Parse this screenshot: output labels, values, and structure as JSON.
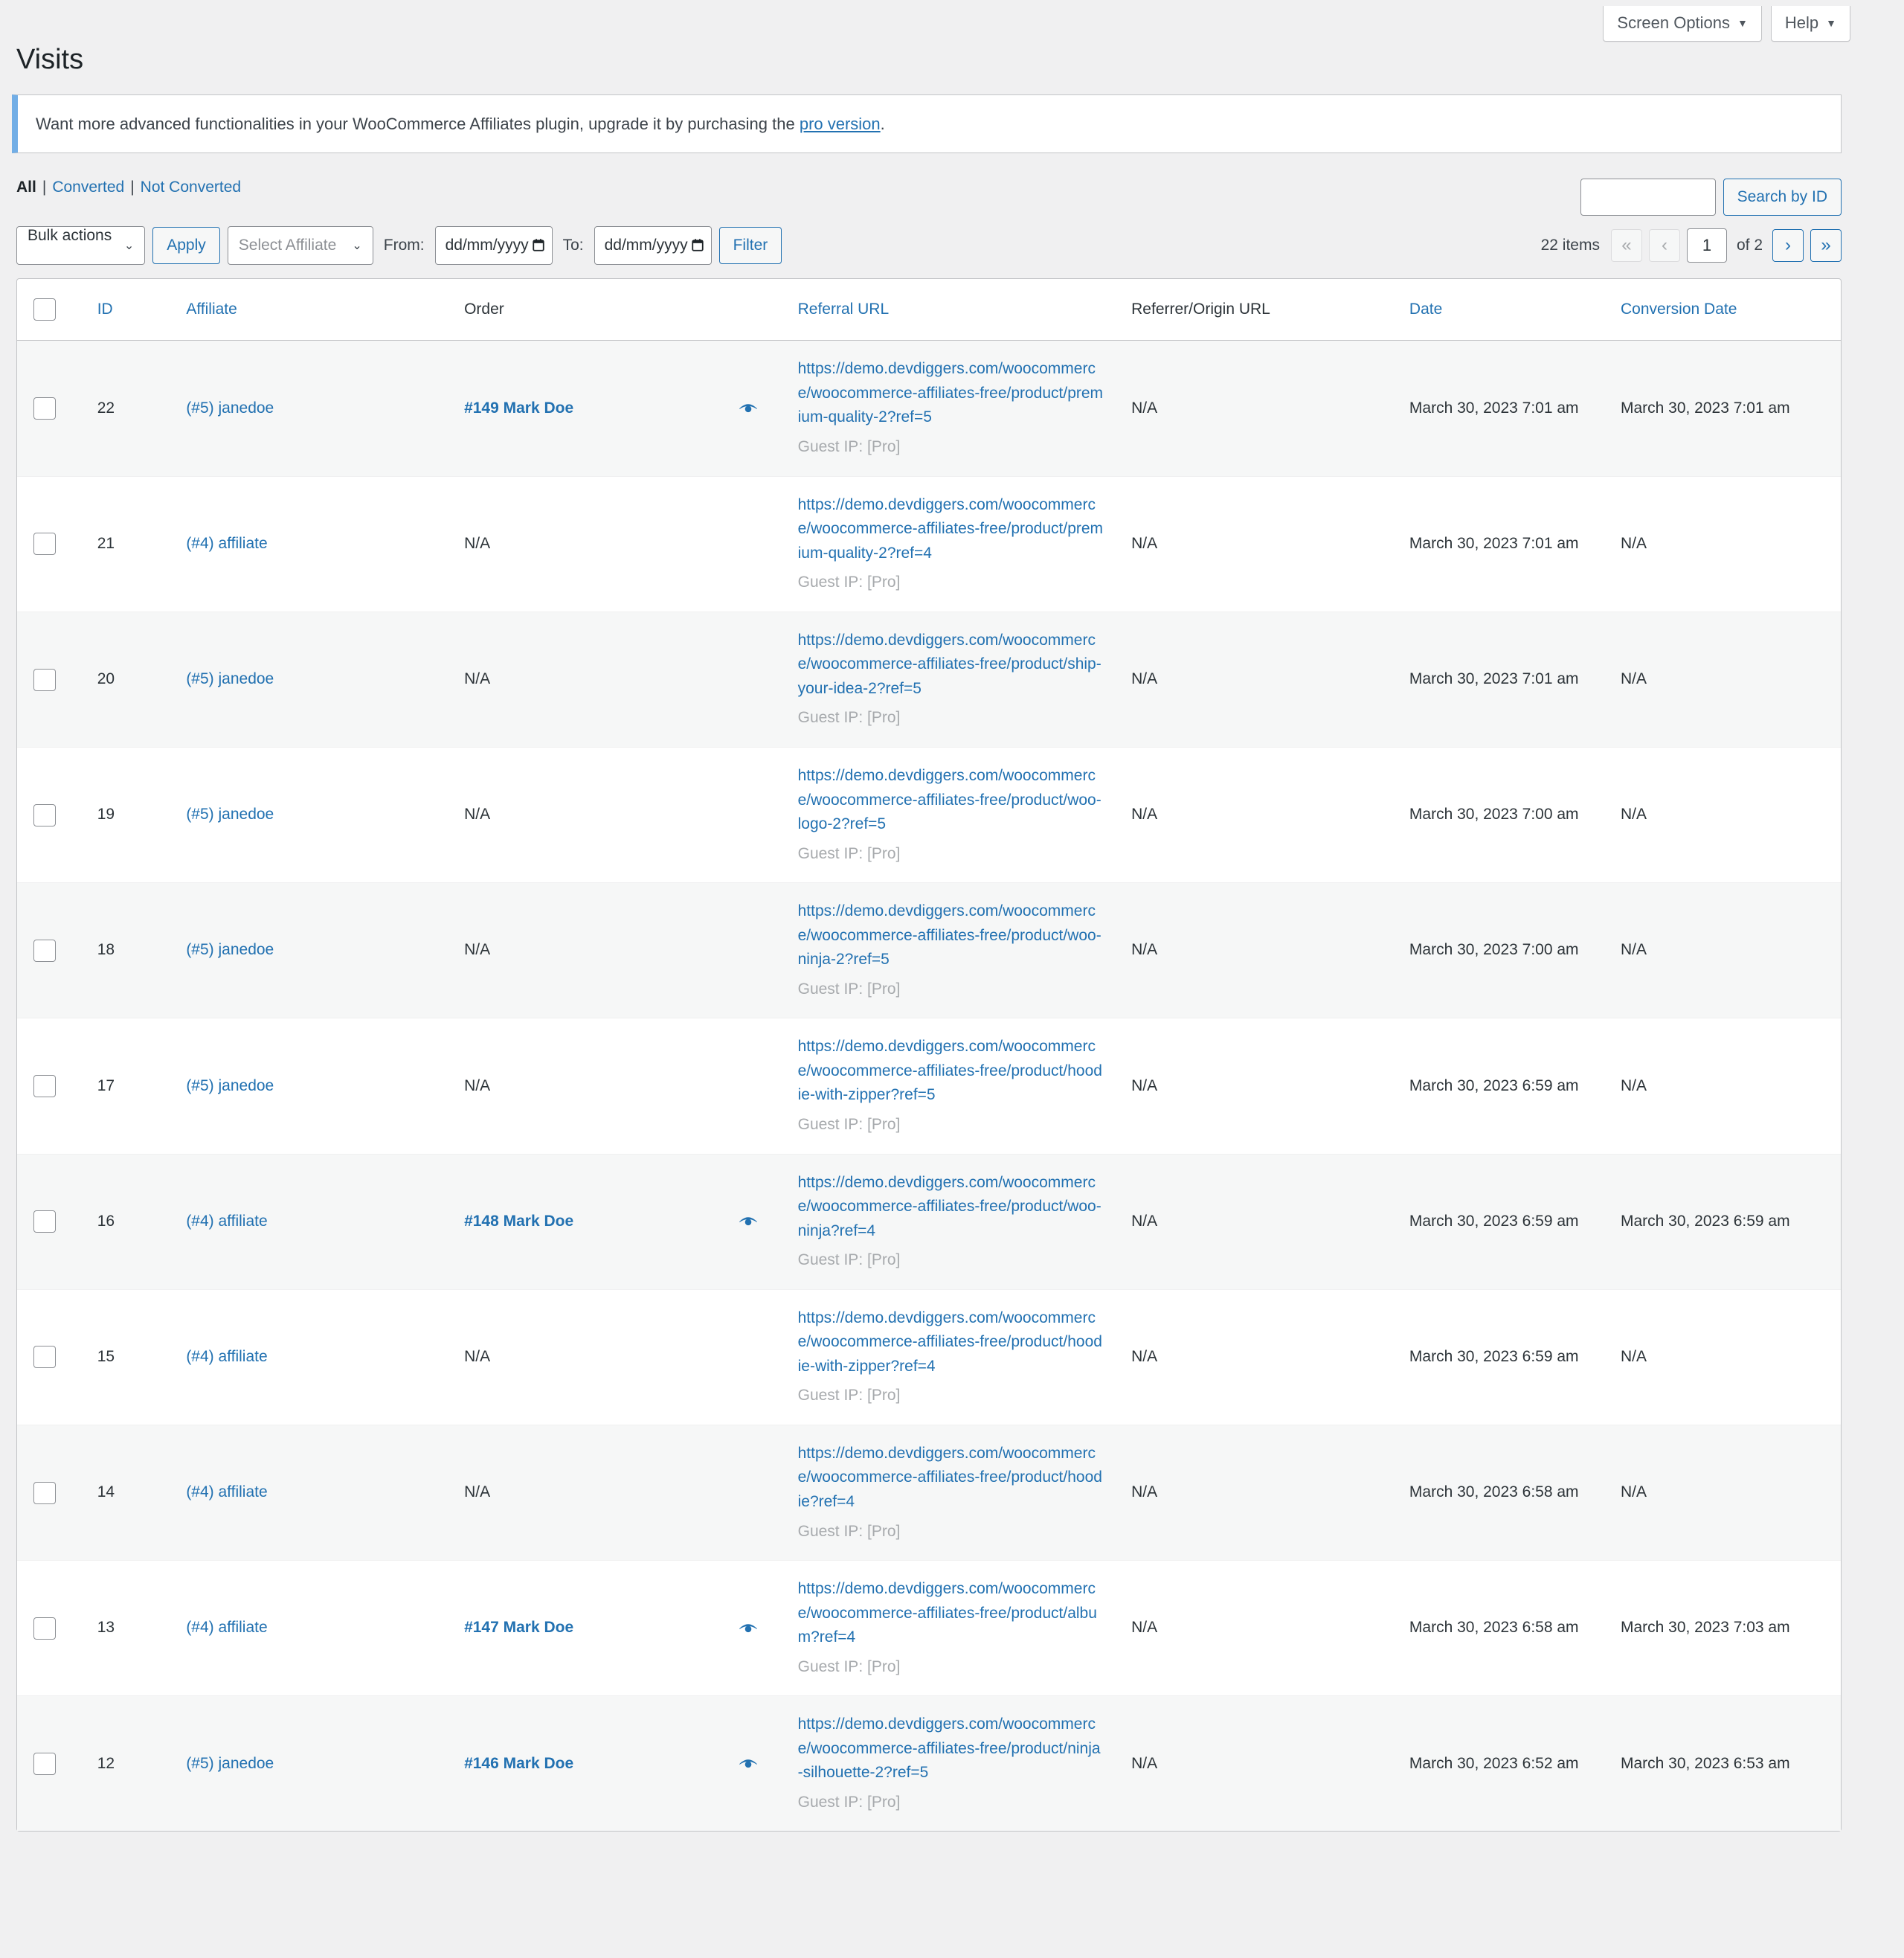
{
  "topbar": {
    "screen_options_label": "Screen Options",
    "help_label": "Help",
    "caret": "▼"
  },
  "page": {
    "title": "Visits"
  },
  "notice": {
    "text_before": "Want more advanced functionalities in your WooCommerce Affiliates plugin, upgrade it by purchasing the ",
    "link_label": "pro version",
    "text_after": "."
  },
  "views": {
    "all": "All",
    "converted": "Converted",
    "not_converted": "Not Converted",
    "separator": "|"
  },
  "search": {
    "value": "",
    "placeholder": "",
    "button_label": "Search by ID"
  },
  "toolbar": {
    "bulk_actions_label": "Bulk actions",
    "apply_label": "Apply",
    "select_affiliate_label": "Select Affiliate",
    "from_label": "From:",
    "to_label": "To:",
    "date_from_value": "dd/mm/yyyy",
    "date_to_value": "dd/mm/yyyy",
    "filter_label": "Filter",
    "caret": "⌄"
  },
  "pagination": {
    "items_label": "22 items",
    "first_label": "«",
    "prev_label": "‹",
    "current_page": "1",
    "of_label": "of 2",
    "next_label": "›",
    "last_label": "»"
  },
  "table": {
    "columns": [
      {
        "key": "cb",
        "label": "",
        "sortable": false
      },
      {
        "key": "id",
        "label": "ID",
        "sortable": true
      },
      {
        "key": "affiliate",
        "label": "Affiliate",
        "sortable": true
      },
      {
        "key": "order",
        "label": "Order",
        "sortable": false
      },
      {
        "key": "referral_url",
        "label": "Referral URL",
        "sortable": true
      },
      {
        "key": "referrer_origin_url",
        "label": "Referrer/Origin URL",
        "sortable": false
      },
      {
        "key": "date",
        "label": "Date",
        "sortable": true
      },
      {
        "key": "conversion_date",
        "label": "Conversion Date",
        "sortable": true
      }
    ],
    "guest_ip_label": "Guest IP: [Pro]",
    "na_label": "N/A",
    "rows": [
      {
        "id": "22",
        "affiliate": "(#5) janedoe <janedoe@email.com>",
        "order": "#149 Mark Doe",
        "has_order_link": true,
        "has_eye_icon": true,
        "referral_url": "https://demo.devdiggers.com/woocommerce/woocommerce-affiliates-free/product/premium-quality-2?ref=5",
        "guest_ip": "Guest IP: [Pro]",
        "referrer_origin_url": "N/A",
        "date": "March 30, 2023 7:01 am",
        "conversion_date": "March 30, 2023 7:01 am"
      },
      {
        "id": "21",
        "affiliate": "(#4) affiliate <affiliate@email.com>",
        "order": "N/A",
        "has_order_link": false,
        "has_eye_icon": false,
        "referral_url": "https://demo.devdiggers.com/woocommerce/woocommerce-affiliates-free/product/premium-quality-2?ref=4",
        "guest_ip": "Guest IP: [Pro]",
        "referrer_origin_url": "N/A",
        "date": "March 30, 2023 7:01 am",
        "conversion_date": "N/A"
      },
      {
        "id": "20",
        "affiliate": "(#5) janedoe <janedoe@email.com>",
        "order": "N/A",
        "has_order_link": false,
        "has_eye_icon": false,
        "referral_url": "https://demo.devdiggers.com/woocommerce/woocommerce-affiliates-free/product/ship-your-idea-2?ref=5",
        "guest_ip": "Guest IP: [Pro]",
        "referrer_origin_url": "N/A",
        "date": "March 30, 2023 7:01 am",
        "conversion_date": "N/A"
      },
      {
        "id": "19",
        "affiliate": "(#5) janedoe <janedoe@email.com>",
        "order": "N/A",
        "has_order_link": false,
        "has_eye_icon": false,
        "referral_url": "https://demo.devdiggers.com/woocommerce/woocommerce-affiliates-free/product/woo-logo-2?ref=5",
        "guest_ip": "Guest IP: [Pro]",
        "referrer_origin_url": "N/A",
        "date": "March 30, 2023 7:00 am",
        "conversion_date": "N/A"
      },
      {
        "id": "18",
        "affiliate": "(#5) janedoe <janedoe@email.com>",
        "order": "N/A",
        "has_order_link": false,
        "has_eye_icon": false,
        "referral_url": "https://demo.devdiggers.com/woocommerce/woocommerce-affiliates-free/product/woo-ninja-2?ref=5",
        "guest_ip": "Guest IP: [Pro]",
        "referrer_origin_url": "N/A",
        "date": "March 30, 2023 7:00 am",
        "conversion_date": "N/A"
      },
      {
        "id": "17",
        "affiliate": "(#5) janedoe <janedoe@email.com>",
        "order": "N/A",
        "has_order_link": false,
        "has_eye_icon": false,
        "referral_url": "https://demo.devdiggers.com/woocommerce/woocommerce-affiliates-free/product/hoodie-with-zipper?ref=5",
        "guest_ip": "Guest IP: [Pro]",
        "referrer_origin_url": "N/A",
        "date": "March 30, 2023 6:59 am",
        "conversion_date": "N/A"
      },
      {
        "id": "16",
        "affiliate": "(#4) affiliate <affiliate@email.com>",
        "order": "#148 Mark Doe",
        "has_order_link": true,
        "has_eye_icon": true,
        "referral_url": "https://demo.devdiggers.com/woocommerce/woocommerce-affiliates-free/product/woo-ninja?ref=4",
        "guest_ip": "Guest IP: [Pro]",
        "referrer_origin_url": "N/A",
        "date": "March 30, 2023 6:59 am",
        "conversion_date": "March 30, 2023 6:59 am"
      },
      {
        "id": "15",
        "affiliate": "(#4) affiliate <affiliate@email.com>",
        "order": "N/A",
        "has_order_link": false,
        "has_eye_icon": false,
        "referral_url": "https://demo.devdiggers.com/woocommerce/woocommerce-affiliates-free/product/hoodie-with-zipper?ref=4",
        "guest_ip": "Guest IP: [Pro]",
        "referrer_origin_url": "N/A",
        "date": "March 30, 2023 6:59 am",
        "conversion_date": "N/A"
      },
      {
        "id": "14",
        "affiliate": "(#4) affiliate <affiliate@email.com>",
        "order": "N/A",
        "has_order_link": false,
        "has_eye_icon": false,
        "referral_url": "https://demo.devdiggers.com/woocommerce/woocommerce-affiliates-free/product/hoodie?ref=4",
        "guest_ip": "Guest IP: [Pro]",
        "referrer_origin_url": "N/A",
        "date": "March 30, 2023 6:58 am",
        "conversion_date": "N/A"
      },
      {
        "id": "13",
        "affiliate": "(#4) affiliate <affiliate@email.com>",
        "order": "#147 Mark Doe",
        "has_order_link": true,
        "has_eye_icon": true,
        "referral_url": "https://demo.devdiggers.com/woocommerce/woocommerce-affiliates-free/product/album?ref=4",
        "guest_ip": "Guest IP: [Pro]",
        "referrer_origin_url": "N/A",
        "date": "March 30, 2023 6:58 am",
        "conversion_date": "March 30, 2023 7:03 am"
      },
      {
        "id": "12",
        "affiliate": "(#5) janedoe <janedoe@email.com>",
        "order": "#146 Mark Doe",
        "has_order_link": true,
        "has_eye_icon": true,
        "referral_url": "https://demo.devdiggers.com/woocommerce/woocommerce-affiliates-free/product/ninja-silhouette-2?ref=5",
        "guest_ip": "Guest IP: [Pro]",
        "referrer_origin_url": "N/A",
        "date": "March 30, 2023 6:52 am",
        "conversion_date": "March 30, 2023 6:53 am"
      }
    ]
  },
  "colors": {
    "link": "#2271b1",
    "notice_accent": "#72aee6",
    "page_bg": "#f0f0f1",
    "row_alt_bg": "#f6f7f7",
    "muted": "#a7aaad"
  }
}
